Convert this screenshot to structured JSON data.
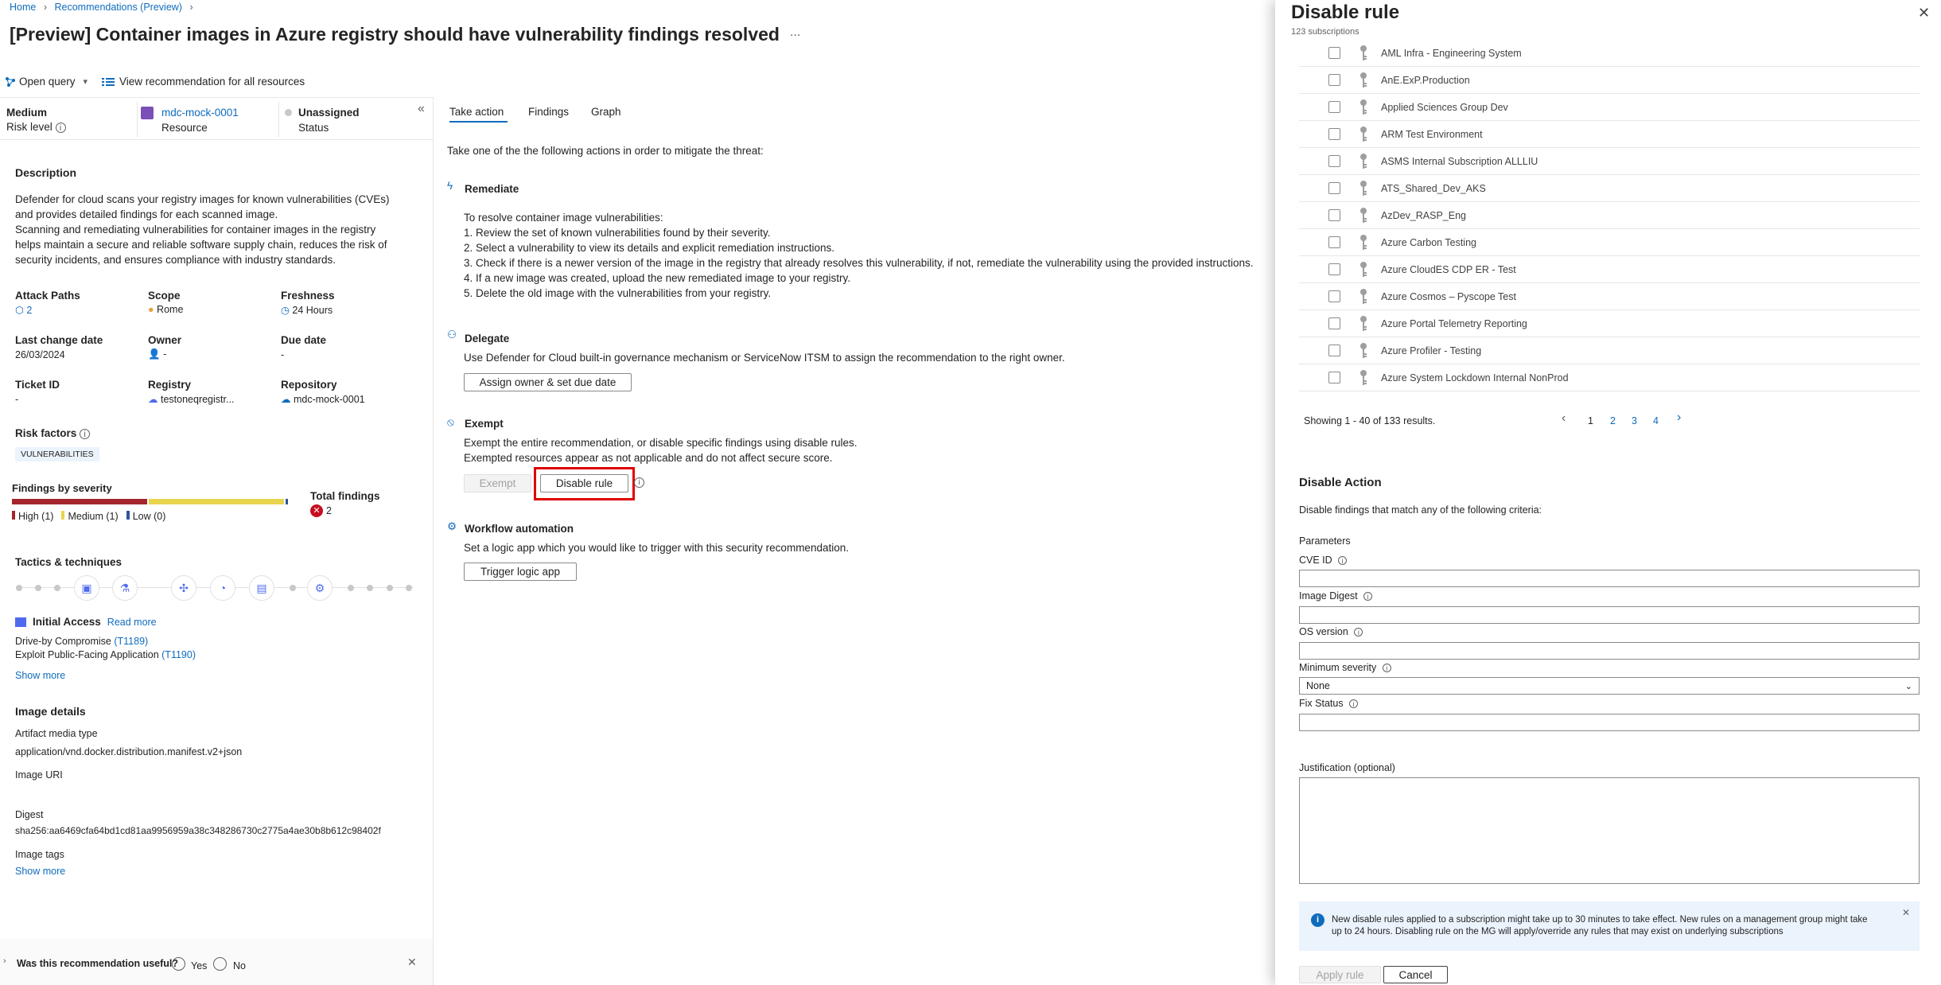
{
  "breadcrumb": {
    "home": "Home",
    "recommendations": "Recommendations (Preview)"
  },
  "page_title": "[Preview] Container images in Azure registry should have vulnerability findings resolved",
  "more_label": "...",
  "toolbar": {
    "open_query": "Open query",
    "view_all": "View recommendation for all resources"
  },
  "summary": {
    "risk_value": "Medium",
    "risk_label": "Risk level",
    "resource_value": "mdc-mock-0001",
    "resource_label": "Resource",
    "status_value": "Unassigned",
    "status_label": "Status"
  },
  "description": {
    "heading": "Description",
    "line1": "Defender for cloud scans your registry images for known vulnerabilities (CVEs)",
    "line2": "and provides detailed findings for each scanned image.",
    "line3": "Scanning and remediating vulnerabilities for container images in the registry",
    "line4": "helps maintain a secure and reliable software supply chain, reduces the risk of",
    "line5": "security incidents, and ensures compliance with industry standards."
  },
  "props": {
    "attack_paths_label": "Attack Paths",
    "attack_paths_value": "2",
    "scope_label": "Scope",
    "scope_value": "Rome",
    "freshness_label": "Freshness",
    "freshness_value": "24 Hours",
    "last_change_label": "Last change date",
    "last_change_value": "26/03/2024",
    "owner_label": "Owner",
    "owner_value": "-",
    "due_date_label": "Due date",
    "due_date_value": "-",
    "ticket_label": "Ticket ID",
    "ticket_value": "-",
    "registry_label": "Registry",
    "registry_value": "testoneqregistr...",
    "repository_label": "Repository",
    "repository_value": "mdc-mock-0001"
  },
  "risk_factors": {
    "heading": "Risk factors",
    "tag": "VULNERABILITIES"
  },
  "findings": {
    "heading": "Findings by severity",
    "high": "High (1)",
    "medium": "Medium (1)",
    "low": "Low (0)",
    "high_count": 1,
    "medium_count": 1,
    "low_count": 0,
    "total_label": "Total findings",
    "total_value": "2",
    "colors": {
      "high": "#a4262c",
      "medium": "#e8d44d",
      "low": "#2b5797"
    }
  },
  "tactics": {
    "heading": "Tactics & techniques",
    "initial_access": "Initial Access",
    "read_more": "Read more",
    "tech1": "Drive-by Compromise",
    "tech1_id": "(T1189)",
    "tech2": "Exploit Public-Facing Application",
    "tech2_id": "(T1190)",
    "show_more": "Show more"
  },
  "image_details": {
    "heading": "Image details",
    "artifact_label": "Artifact media type",
    "artifact_value": "application/vnd.docker.distribution.manifest.v2+json",
    "uri_label": "Image URI",
    "digest_label": "Digest",
    "digest_value": "sha256:aa6469cfa64bd1cd81aa9956959a38c348286730c2775a4ae30b8b612c98402f",
    "tags_label": "Image tags",
    "show_more": "Show more"
  },
  "feedback": {
    "question": "Was this recommendation useful?",
    "yes": "Yes",
    "no": "No"
  },
  "tabs": {
    "take_action": "Take action",
    "findings": "Findings",
    "graph": "Graph"
  },
  "take_action": {
    "intro": "Take one of the the following actions in order to mitigate the threat:",
    "remediate_heading": "Remediate",
    "rem_intro": "To resolve container image vulnerabilities:",
    "rem1": "1. Review the set of known vulnerabilities found by their severity.",
    "rem2": "2. Select a vulnerability to view its details and explicit remediation instructions.",
    "rem3": "3. Check if there is a newer version of the image in the registry that already resolves this vulnerability, if not, remediate the vulnerability using the provided instructions.",
    "rem4": "4. If a new image was created, upload the new remediated image to your registry.",
    "rem5": "5. Delete the old image with the vulnerabilities from your registry.",
    "delegate_heading": "Delegate",
    "delegate_text": "Use Defender for Cloud built-in governance mechanism or ServiceNow ITSM to assign the recommendation to the right owner.",
    "assign_button": "Assign owner & set due date",
    "exempt_heading": "Exempt",
    "exempt_text1": "Exempt the entire recommendation, or disable specific findings using disable rules.",
    "exempt_text2": "Exempted resources appear as not applicable and do not affect secure score.",
    "exempt_button": "Exempt",
    "disable_rule_button": "Disable rule",
    "workflow_heading": "Workflow automation",
    "workflow_text": "Set a logic app which you would like to trigger with this security recommendation.",
    "trigger_button": "Trigger logic app"
  },
  "panel": {
    "title": "Disable rule",
    "subtitle": "123 subscriptions",
    "subscriptions": [
      "AML Infra - Engineering System",
      "AnE.ExP.Production",
      "Applied Sciences Group Dev",
      "ARM Test Environment",
      "ASMS Internal Subscription ALLLIU",
      "ATS_Shared_Dev_AKS",
      "AzDev_RASP_Eng",
      "Azure Carbon Testing",
      "Azure CloudES CDP ER - Test",
      "Azure Cosmos – Pyscope Test",
      "Azure Portal Telemetry Reporting",
      "Azure Profiler - Testing",
      "Azure System Lockdown Internal NonProd"
    ],
    "showing": "Showing 1 - 40 of 133 results.",
    "pages": [
      "1",
      "2",
      "3",
      "4"
    ],
    "action_heading": "Disable Action",
    "action_desc": "Disable findings that match any of the following criteria:",
    "parameters": "Parameters",
    "cve_label": "CVE ID",
    "digest_label": "Image Digest",
    "os_label": "OS version",
    "severity_label": "Minimum severity",
    "severity_value": "None",
    "fix_label": "Fix Status",
    "justification_label": "Justification (optional)",
    "info_text1": "New disable rules applied to a subscription might take up to 30 minutes to take effect. New rules on a management group might take",
    "info_text2": "up to 24 hours. Disabling rule on the MG will apply/override any rules that may exist on underlying subscriptions",
    "apply_button": "Apply rule",
    "cancel_button": "Cancel"
  }
}
